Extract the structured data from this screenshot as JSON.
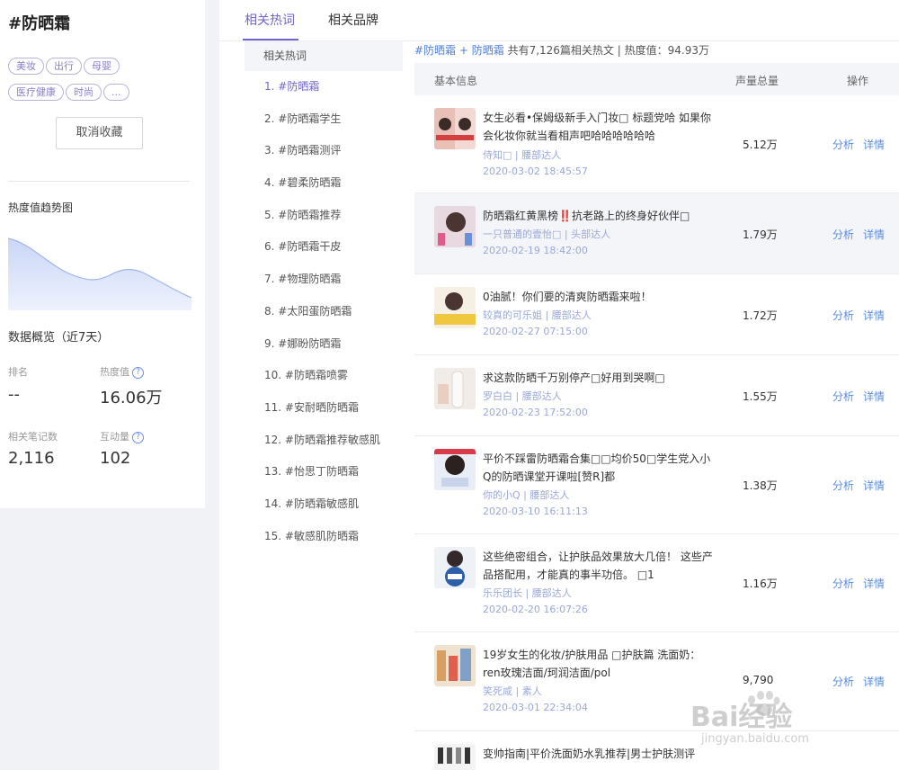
{
  "topic": {
    "title": "#防晒霜",
    "tags": [
      "美妆",
      "出行",
      "母婴",
      "医疗健康",
      "时尚",
      "..."
    ],
    "unfavorite_label": "取消收藏"
  },
  "trend": {
    "title": "热度值趋势图"
  },
  "overview": {
    "title": "数据概览（近7天）",
    "rank_label": "排名",
    "rank_value": "--",
    "heat_label": "热度值",
    "heat_value": "16.06万",
    "notes_label": "相关笔记数",
    "notes_value": "2,116",
    "interact_label": "互动量",
    "interact_value": "102",
    "help_icon": "question-circle-icon"
  },
  "tabs": [
    "相关热词",
    "相关品牌"
  ],
  "keywords": {
    "header": "相关热词",
    "items": [
      "1. #防晒霜",
      "2. #防晒霜学生",
      "3. #防晒霜测评",
      "4. #碧柔防晒霜",
      "5. #防晒霜推荐",
      "6. #防晒霜干皮",
      "7. #物理防晒霜",
      "8. #太阳蛋防晒霜",
      "9. #娜盼防晒霜",
      "10. #防晒霜喷雾",
      "11. #安耐晒防晒霜",
      "12. #防晒霜推荐敏感肌",
      "13. #怡思丁防晒霜",
      "14. #防晒霜敏感肌",
      "15. #敏感肌防晒霜"
    ]
  },
  "crumb": {
    "part1": "#防晒霜",
    "sep": " + ",
    "part2": "防晒霜",
    "rest": " 共有7,126篇相关热文 | 热度值：94.93万"
  },
  "table": {
    "col_info": "基本信息",
    "col_volume": "声量总量",
    "col_action": "操作",
    "analyze_label": "分析",
    "detail_label": "详情",
    "rows": [
      {
        "title": "女生必看•保姆级新手入门妆□ 标题党哈 如果你会化妆你就当看相声吧哈哈哈哈哈哈",
        "author": "侍知□ | 腰部达人",
        "date": "2020-03-02 18:45:57",
        "volume": "5.12万"
      },
      {
        "title": "防晒霜红黄黑榜‼️抗老路上的终身好伙伴□",
        "author": "一只普通的壹怡□ | 头部达人",
        "date": "2020-02-19 18:42:00",
        "volume": "1.79万"
      },
      {
        "title": "0油腻！你们要的清爽防晒霜来啦！",
        "author": "较真的可乐姐 | 腰部达人",
        "date": "2020-02-27 07:15:00",
        "volume": "1.72万"
      },
      {
        "title": "求这款防晒千万别停产□好用到哭啊□",
        "author": "罗白白 | 腰部达人",
        "date": "2020-02-23 17:52:00",
        "volume": "1.55万"
      },
      {
        "title": "平价不踩雷防晒霜合集□□均价50□学生党入小Q的防晒课堂开课啦[赞R]都",
        "author": "你的小Q | 腰部达人",
        "date": "2020-03-10 16:11:13",
        "volume": "1.38万"
      },
      {
        "title": "这些绝密组合，让护肤品效果放大几倍！ 这些产品搭配用，才能真的事半功倍。 □1",
        "author": "乐乐团长 | 腰部达人",
        "date": "2020-02-20 16:07:26",
        "volume": "1.16万"
      },
      {
        "title": "19岁女生的化妆/护肤用品 □护肤篇 洗面奶：ren玫瑰洁面/珂润洁面/pol",
        "author": "笑死咸 | 素人",
        "date": "2020-03-01 22:34:04",
        "volume": "9,790"
      },
      {
        "title": "变帅指南|平价洗面奶水乳推荐|男士护肤测评",
        "author": "",
        "date": "",
        "volume": ""
      }
    ]
  },
  "watermark": {
    "brand": "Bai经验",
    "url": "jingyan.baidu.com"
  }
}
